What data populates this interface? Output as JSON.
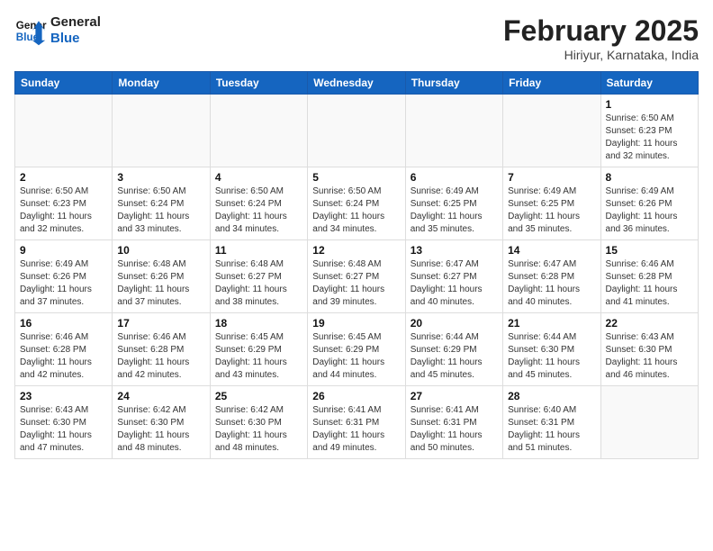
{
  "header": {
    "logo_general": "General",
    "logo_blue": "Blue",
    "month_title": "February 2025",
    "location": "Hiriyur, Karnataka, India"
  },
  "days_of_week": [
    "Sunday",
    "Monday",
    "Tuesday",
    "Wednesday",
    "Thursday",
    "Friday",
    "Saturday"
  ],
  "weeks": [
    [
      {
        "day": "",
        "info": ""
      },
      {
        "day": "",
        "info": ""
      },
      {
        "day": "",
        "info": ""
      },
      {
        "day": "",
        "info": ""
      },
      {
        "day": "",
        "info": ""
      },
      {
        "day": "",
        "info": ""
      },
      {
        "day": "1",
        "info": "Sunrise: 6:50 AM\nSunset: 6:23 PM\nDaylight: 11 hours\nand 32 minutes."
      }
    ],
    [
      {
        "day": "2",
        "info": "Sunrise: 6:50 AM\nSunset: 6:23 PM\nDaylight: 11 hours\nand 32 minutes."
      },
      {
        "day": "3",
        "info": "Sunrise: 6:50 AM\nSunset: 6:24 PM\nDaylight: 11 hours\nand 33 minutes."
      },
      {
        "day": "4",
        "info": "Sunrise: 6:50 AM\nSunset: 6:24 PM\nDaylight: 11 hours\nand 34 minutes."
      },
      {
        "day": "5",
        "info": "Sunrise: 6:50 AM\nSunset: 6:24 PM\nDaylight: 11 hours\nand 34 minutes."
      },
      {
        "day": "6",
        "info": "Sunrise: 6:49 AM\nSunset: 6:25 PM\nDaylight: 11 hours\nand 35 minutes."
      },
      {
        "day": "7",
        "info": "Sunrise: 6:49 AM\nSunset: 6:25 PM\nDaylight: 11 hours\nand 35 minutes."
      },
      {
        "day": "8",
        "info": "Sunrise: 6:49 AM\nSunset: 6:26 PM\nDaylight: 11 hours\nand 36 minutes."
      }
    ],
    [
      {
        "day": "9",
        "info": "Sunrise: 6:49 AM\nSunset: 6:26 PM\nDaylight: 11 hours\nand 37 minutes."
      },
      {
        "day": "10",
        "info": "Sunrise: 6:48 AM\nSunset: 6:26 PM\nDaylight: 11 hours\nand 37 minutes."
      },
      {
        "day": "11",
        "info": "Sunrise: 6:48 AM\nSunset: 6:27 PM\nDaylight: 11 hours\nand 38 minutes."
      },
      {
        "day": "12",
        "info": "Sunrise: 6:48 AM\nSunset: 6:27 PM\nDaylight: 11 hours\nand 39 minutes."
      },
      {
        "day": "13",
        "info": "Sunrise: 6:47 AM\nSunset: 6:27 PM\nDaylight: 11 hours\nand 40 minutes."
      },
      {
        "day": "14",
        "info": "Sunrise: 6:47 AM\nSunset: 6:28 PM\nDaylight: 11 hours\nand 40 minutes."
      },
      {
        "day": "15",
        "info": "Sunrise: 6:46 AM\nSunset: 6:28 PM\nDaylight: 11 hours\nand 41 minutes."
      }
    ],
    [
      {
        "day": "16",
        "info": "Sunrise: 6:46 AM\nSunset: 6:28 PM\nDaylight: 11 hours\nand 42 minutes."
      },
      {
        "day": "17",
        "info": "Sunrise: 6:46 AM\nSunset: 6:28 PM\nDaylight: 11 hours\nand 42 minutes."
      },
      {
        "day": "18",
        "info": "Sunrise: 6:45 AM\nSunset: 6:29 PM\nDaylight: 11 hours\nand 43 minutes."
      },
      {
        "day": "19",
        "info": "Sunrise: 6:45 AM\nSunset: 6:29 PM\nDaylight: 11 hours\nand 44 minutes."
      },
      {
        "day": "20",
        "info": "Sunrise: 6:44 AM\nSunset: 6:29 PM\nDaylight: 11 hours\nand 45 minutes."
      },
      {
        "day": "21",
        "info": "Sunrise: 6:44 AM\nSunset: 6:30 PM\nDaylight: 11 hours\nand 45 minutes."
      },
      {
        "day": "22",
        "info": "Sunrise: 6:43 AM\nSunset: 6:30 PM\nDaylight: 11 hours\nand 46 minutes."
      }
    ],
    [
      {
        "day": "23",
        "info": "Sunrise: 6:43 AM\nSunset: 6:30 PM\nDaylight: 11 hours\nand 47 minutes."
      },
      {
        "day": "24",
        "info": "Sunrise: 6:42 AM\nSunset: 6:30 PM\nDaylight: 11 hours\nand 48 minutes."
      },
      {
        "day": "25",
        "info": "Sunrise: 6:42 AM\nSunset: 6:30 PM\nDaylight: 11 hours\nand 48 minutes."
      },
      {
        "day": "26",
        "info": "Sunrise: 6:41 AM\nSunset: 6:31 PM\nDaylight: 11 hours\nand 49 minutes."
      },
      {
        "day": "27",
        "info": "Sunrise: 6:41 AM\nSunset: 6:31 PM\nDaylight: 11 hours\nand 50 minutes."
      },
      {
        "day": "28",
        "info": "Sunrise: 6:40 AM\nSunset: 6:31 PM\nDaylight: 11 hours\nand 51 minutes."
      },
      {
        "day": "",
        "info": ""
      }
    ]
  ]
}
